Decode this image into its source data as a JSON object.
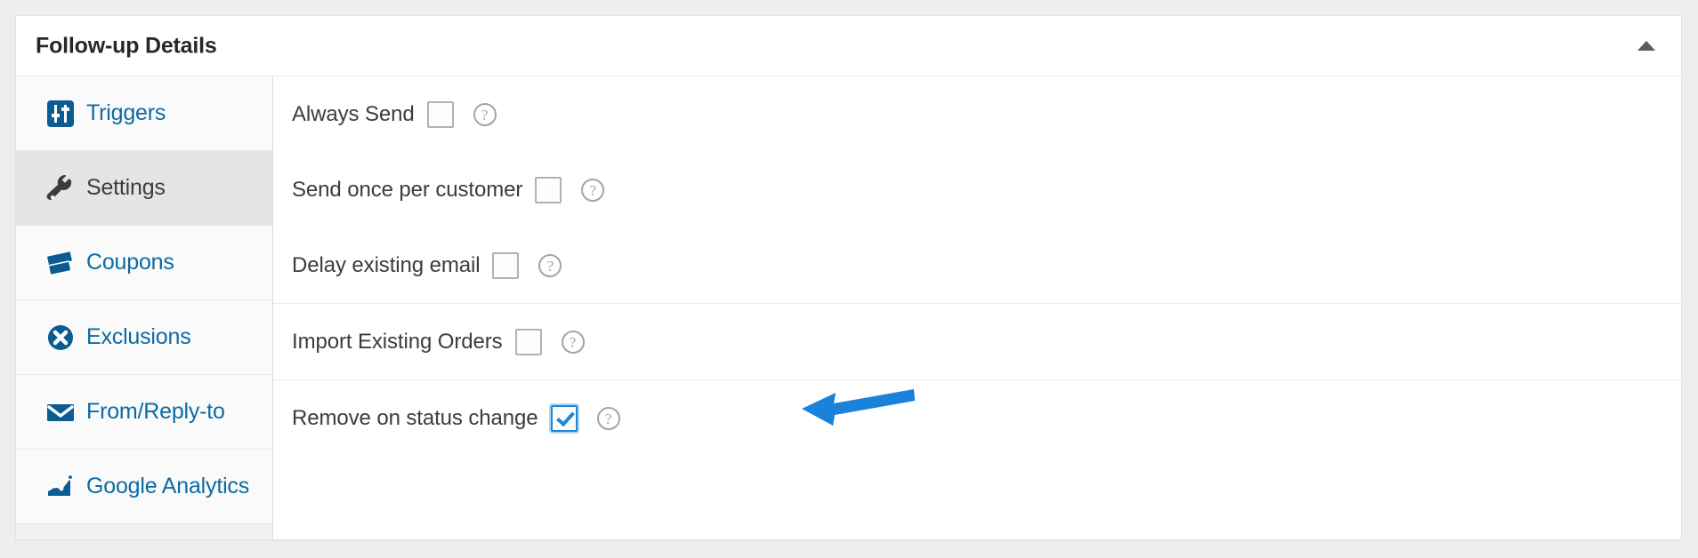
{
  "panel": {
    "title": "Follow-up Details",
    "collapse_icon": "caret-up-icon"
  },
  "sidebar": {
    "items": [
      {
        "label": "Triggers",
        "icon": "sliders-icon",
        "active": false
      },
      {
        "label": "Settings",
        "icon": "wrench-icon",
        "active": true
      },
      {
        "label": "Coupons",
        "icon": "tickets-icon",
        "active": false
      },
      {
        "label": "Exclusions",
        "icon": "x-circle-icon",
        "active": false
      },
      {
        "label": "From/Reply-to",
        "icon": "envelope-icon",
        "active": false
      },
      {
        "label": "Google Analytics",
        "icon": "area-chart-icon",
        "active": false
      }
    ]
  },
  "content": {
    "groups": [
      {
        "rows": [
          {
            "label": "Always Send",
            "checked": false,
            "help": "help-icon"
          },
          {
            "label": "Send once per customer",
            "checked": false,
            "help": "help-icon"
          },
          {
            "label": "Delay existing email",
            "checked": false,
            "help": "help-icon"
          }
        ]
      },
      {
        "rows": [
          {
            "label": "Import Existing Orders",
            "checked": false,
            "help": "help-icon"
          }
        ]
      },
      {
        "rows": [
          {
            "label": "Remove on status change",
            "checked": true,
            "help": "help-icon"
          }
        ]
      }
    ]
  },
  "annotation": {
    "type": "arrow",
    "direction": "left",
    "color": "#1a82da",
    "points_at": "Remove on status change"
  },
  "colors": {
    "link": "#0b6ba3",
    "accent": "#1a82da",
    "text": "#3c3c3c",
    "title": "#23282d",
    "panel_bg": "#ffffff",
    "page_bg": "#eeeeee",
    "sidebar_bg": "#fafafa",
    "sidebar_active_bg": "#e5e5e5"
  }
}
